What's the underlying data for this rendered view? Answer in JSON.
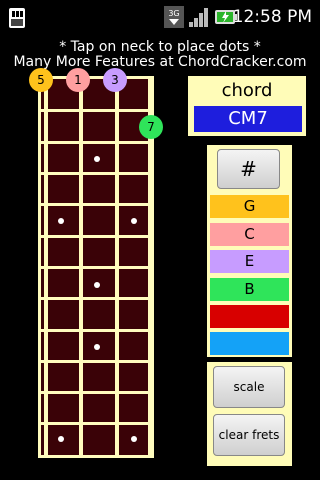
{
  "status_bar": {
    "network": "3G",
    "time": "12:58 PM"
  },
  "hint": {
    "line1": "* Tap on neck to place dots *",
    "line2": "Many More Features at ChordCracker.com"
  },
  "neck": {
    "dots": [
      {
        "label": "5",
        "color": "#ffc21c"
      },
      {
        "label": "1",
        "color": "#ff9fa0"
      },
      {
        "label": "3",
        "color": "#c79cff"
      },
      {
        "label": "7",
        "color": "#2fe45a"
      }
    ]
  },
  "chord": {
    "label": "chord",
    "name": "CM7"
  },
  "notes": {
    "sharp_label": "#",
    "items": [
      {
        "label": "G",
        "color": "#ffc21c"
      },
      {
        "label": "C",
        "color": "#ff9fa0"
      },
      {
        "label": "E",
        "color": "#c79cff"
      },
      {
        "label": "B",
        "color": "#2fe45a"
      },
      {
        "label": "",
        "color": "#d80000"
      },
      {
        "label": "",
        "color": "#14a2f7"
      }
    ]
  },
  "actions": {
    "scale_label": "scale",
    "clear_label": "clear frets"
  }
}
